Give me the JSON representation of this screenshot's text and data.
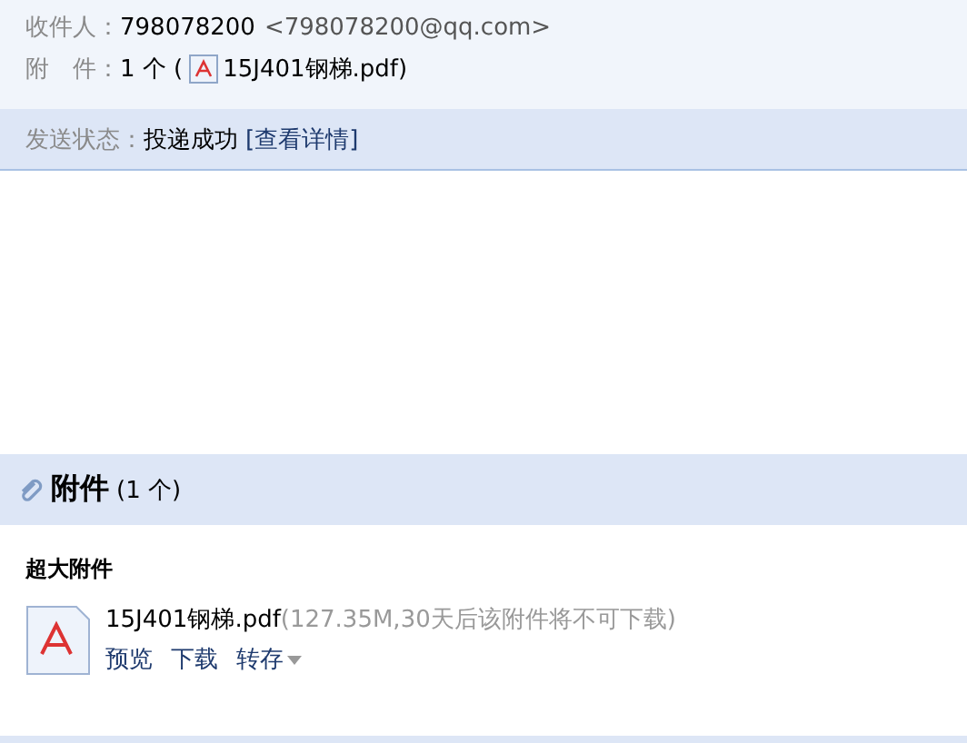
{
  "header": {
    "recipient": {
      "label": "收件人：",
      "name": "798078200",
      "address": "<798078200@qq.com>"
    },
    "attachment": {
      "label": "附　件：",
      "count": "1 个 (",
      "file": "15J401钢梯.pdf",
      "close": ")"
    }
  },
  "status": {
    "label": "发送状态：",
    "value": "投递成功",
    "link": "[查看详情]"
  },
  "attachments": {
    "title": "附件",
    "count": "(1 个)",
    "section": "超大附件",
    "files": [
      {
        "name": "15J401钢梯.pdf",
        "info": "(127.35M,30天后该附件将不可下载)",
        "actions": [
          "预览",
          "下载",
          "转存"
        ]
      }
    ]
  }
}
